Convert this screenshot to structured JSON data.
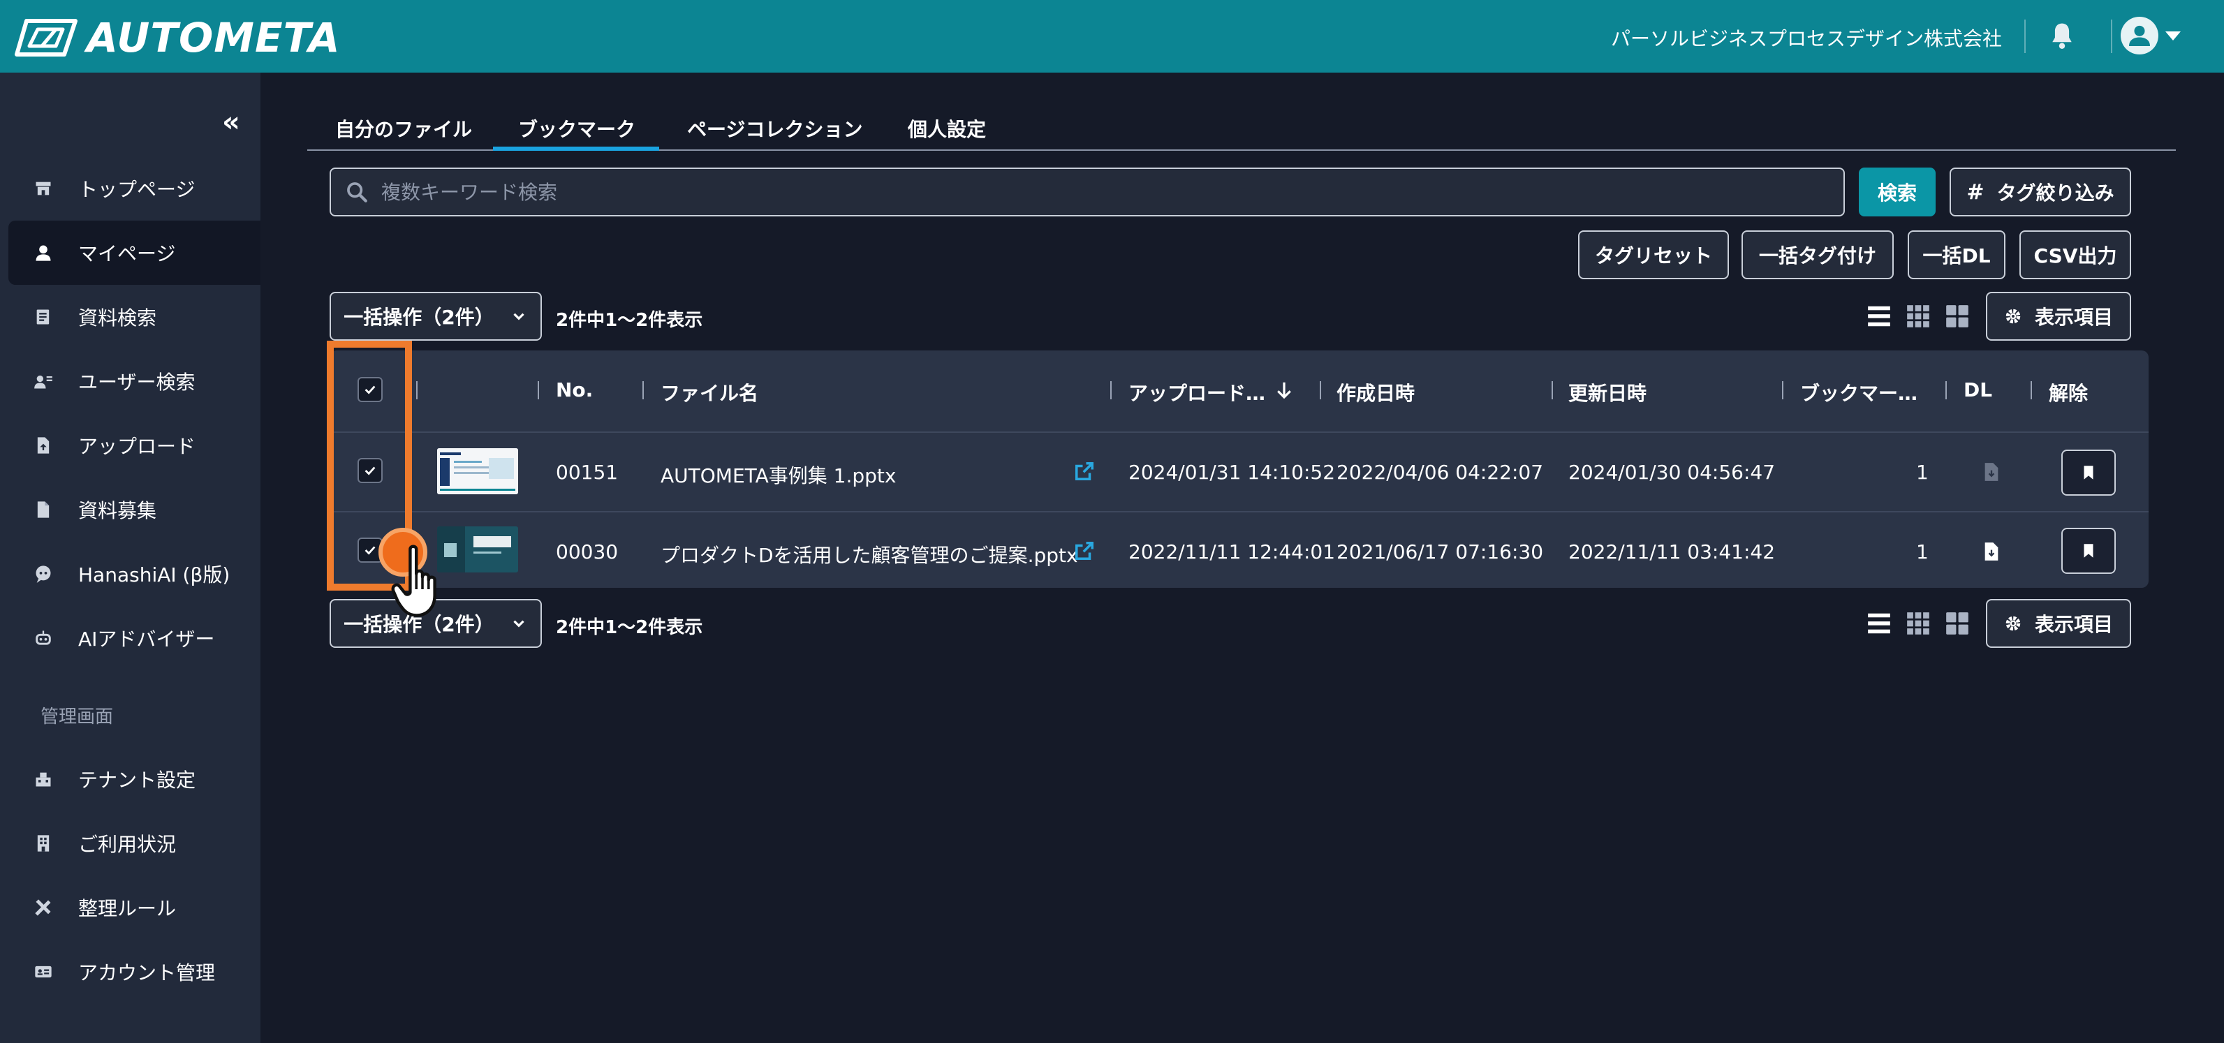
{
  "header": {
    "logo_text": "AUTOMETA",
    "company": "パーソルビジネスプロセスデザイン株式会社"
  },
  "sidebar": {
    "collapse_glyph": "«",
    "items": [
      {
        "label": "トップページ",
        "icon": "store-icon"
      },
      {
        "label": "マイページ",
        "icon": "person-icon",
        "active": true
      },
      {
        "label": "資料検索",
        "icon": "document-search-icon"
      },
      {
        "label": "ユーザー検索",
        "icon": "user-search-icon"
      },
      {
        "label": "アップロード",
        "icon": "file-upload-icon"
      },
      {
        "label": "資料募集",
        "icon": "file-icon"
      },
      {
        "label": "HanashiAI (β版)",
        "icon": "chat-ai-icon"
      },
      {
        "label": "AIアドバイザー",
        "icon": "robot-icon"
      }
    ],
    "section_label": "管理画面",
    "admin_items": [
      {
        "label": "テナント設定",
        "icon": "tenant-icon"
      },
      {
        "label": "ご利用状況",
        "icon": "building-icon"
      },
      {
        "label": "整理ルール",
        "icon": "tools-icon"
      },
      {
        "label": "アカウント管理",
        "icon": "id-card-icon"
      }
    ]
  },
  "tabs": [
    "自分のファイル",
    "ブックマーク",
    "ページコレクション",
    "個人設定"
  ],
  "active_tab": "ブックマーク",
  "search": {
    "placeholder": "複数キーワード検索",
    "search_button": "検索",
    "tag_filter_button": "タグ絞り込み"
  },
  "actions": {
    "tag_reset": "タグリセット",
    "bulk_tag": "一括タグ付け",
    "bulk_dl": "一括DL",
    "csv_export": "CSV出力"
  },
  "list_controls": {
    "bulk_operation": "一括操作（2件）",
    "count_text": "2件中1〜2件表示",
    "display_items": "表示項目"
  },
  "table": {
    "headers": {
      "no": "No.",
      "file_name": "ファイル名",
      "uploaded": "アップロード…",
      "created": "作成日時",
      "updated": "更新日時",
      "bookmarks": "ブックマー…",
      "dl": "DL",
      "remove": "解除"
    },
    "rows": [
      {
        "no": "00151",
        "file_name": "AUTOMETA事例集 1.pptx",
        "uploaded": "2024/01/31 14:10:52",
        "created": "2022/04/06 04:22:07",
        "updated": "2024/01/30 04:56:47",
        "bookmarks": "1",
        "checked": true,
        "dl_enabled": false
      },
      {
        "no": "00030",
        "file_name": "プロダクトDを活用した顧客管理のご提案.pptx",
        "uploaded": "2022/11/11 12:44:01",
        "created": "2021/06/17 07:16:30",
        "updated": "2022/11/11 03:41:42",
        "bookmarks": "1",
        "checked": true,
        "dl_enabled": true
      }
    ]
  },
  "colors": {
    "header": "#0c8593",
    "sidebar": "#222a3b",
    "content": "#151a28",
    "primary_button": "#0b96a6",
    "tab_underline": "#1aa3e0",
    "highlight": "#ef7b2d",
    "link_icon": "#29a8e0"
  }
}
